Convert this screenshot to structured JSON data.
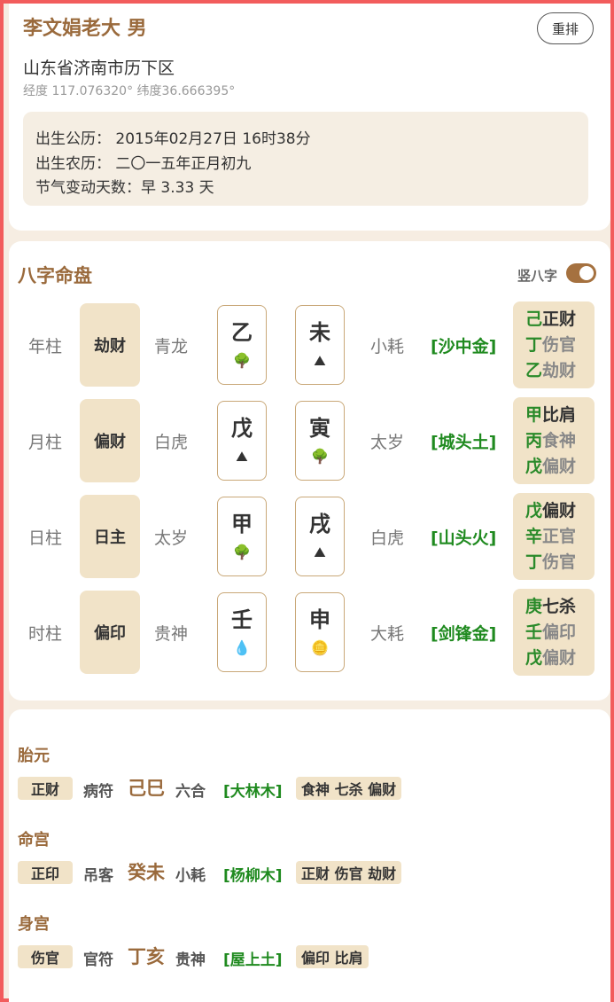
{
  "header": {
    "name": "李文娟老大 男",
    "reset_label": "重排",
    "address": "山东省济南市历下区",
    "coords": "经度 117.076320° 纬度36.666395°",
    "birth_solar": "出生公历： 2015年02月27日 16时38分",
    "birth_lunar": "出生农历： 二〇一五年正月初九",
    "solar_term": "节气变动天数：早 3.33 天"
  },
  "bazi": {
    "title": "八字命盘",
    "toggle_label": "竖八字",
    "toggle_on": true,
    "pillars": [
      {
        "label": "年柱",
        "ten_god": "劫财",
        "star": "青龙",
        "stem": "乙",
        "stem_icon": "tree-icon",
        "branch": "未",
        "branch_icon": "mountain-icon",
        "star2": "小耗",
        "nayin": "[沙中金]",
        "hidden": [
          {
            "stem": "己",
            "god": "正财",
            "strong": true
          },
          {
            "stem": "丁",
            "god": "伤官",
            "strong": false
          },
          {
            "stem": "乙",
            "god": "劫财",
            "strong": false
          }
        ]
      },
      {
        "label": "月柱",
        "ten_god": "偏财",
        "star": "白虎",
        "stem": "戊",
        "stem_icon": "mountain-icon",
        "branch": "寅",
        "branch_icon": "tree-icon",
        "star2": "太岁",
        "nayin": "[城头土]",
        "hidden": [
          {
            "stem": "甲",
            "god": "比肩",
            "strong": true
          },
          {
            "stem": "丙",
            "god": "食神",
            "strong": false
          },
          {
            "stem": "戊",
            "god": "偏财",
            "strong": false
          }
        ]
      },
      {
        "label": "日柱",
        "ten_god": "日主",
        "star": "太岁",
        "stem": "甲",
        "stem_icon": "tree-icon",
        "branch": "戌",
        "branch_icon": "mountain-icon",
        "star2": "白虎",
        "nayin": "[山头火]",
        "hidden": [
          {
            "stem": "戊",
            "god": "偏财",
            "strong": true
          },
          {
            "stem": "辛",
            "god": "正官",
            "strong": false
          },
          {
            "stem": "丁",
            "god": "伤官",
            "strong": false
          }
        ]
      },
      {
        "label": "时柱",
        "ten_god": "偏印",
        "star": "贵神",
        "stem": "壬",
        "stem_icon": "water-drop-icon",
        "branch": "申",
        "branch_icon": "coin-icon",
        "star2": "大耗",
        "nayin": "[剑锋金]",
        "hidden": [
          {
            "stem": "庚",
            "god": "七杀",
            "strong": true
          },
          {
            "stem": "壬",
            "god": "偏印",
            "strong": false
          },
          {
            "stem": "戊",
            "god": "偏财",
            "strong": false
          }
        ]
      }
    ]
  },
  "extra": [
    {
      "title": "胎元",
      "ten_god": "正财",
      "star": "病符",
      "ganzhi": "己巳",
      "star2": "六合",
      "nayin": "[大林木]",
      "gods": "食神 七杀 偏财"
    },
    {
      "title": "命宫",
      "ten_god": "正印",
      "star": "吊客",
      "ganzhi": "癸未",
      "star2": "小耗",
      "nayin": "[杨柳木]",
      "gods": "正财 伤官 劫财"
    },
    {
      "title": "身宫",
      "ten_god": "伤官",
      "star": "官符",
      "ganzhi": "丁亥",
      "star2": "贵神",
      "nayin": "[屋上土]",
      "gods": "偏印 比肩"
    }
  ]
}
